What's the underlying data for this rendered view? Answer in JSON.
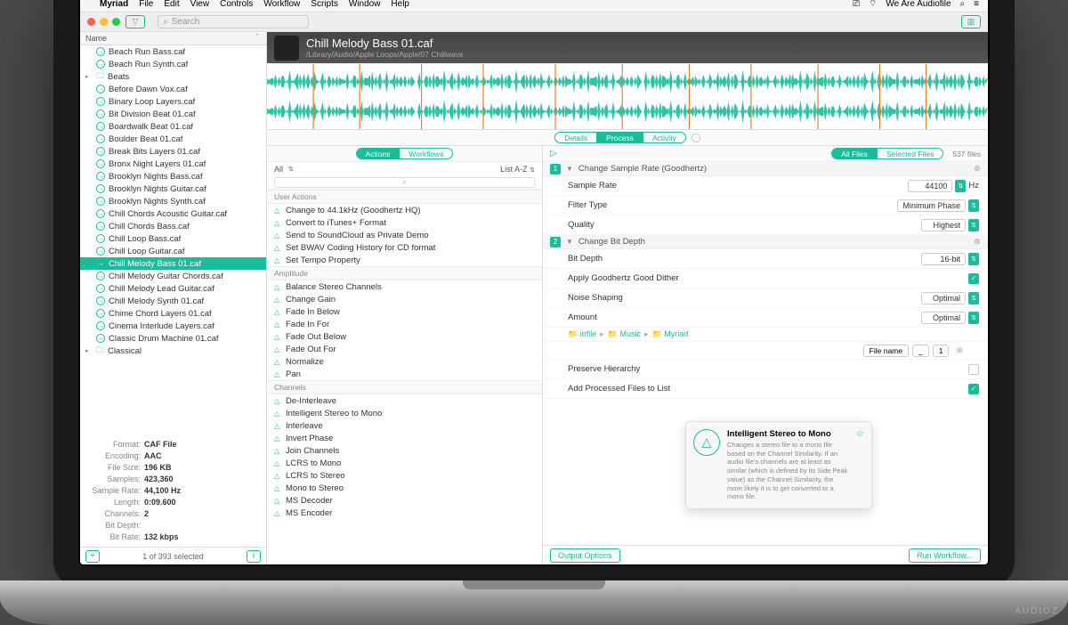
{
  "menubar": {
    "app": "Myriad",
    "items": [
      "File",
      "Edit",
      "View",
      "Controls",
      "Workflow",
      "Scripts",
      "Window",
      "Help"
    ],
    "right": "We Are Audiofile"
  },
  "toolbar": {
    "search_placeholder": "Search"
  },
  "list": {
    "header": "Name",
    "status": "1 of 393 selected"
  },
  "files": [
    {
      "name": "Beach Run Bass.caf",
      "icon": "a"
    },
    {
      "name": "Beach Run Synth.caf",
      "icon": "a"
    },
    {
      "name": "Beats",
      "folder": true,
      "expand": true
    },
    {
      "name": "Before Dawn Vox.caf",
      "icon": "a"
    },
    {
      "name": "Binary Loop Layers.caf",
      "icon": "a"
    },
    {
      "name": "Bit Division Beat 01.caf",
      "icon": "a"
    },
    {
      "name": "Boardwalk Beat 01.caf",
      "icon": "a"
    },
    {
      "name": "Boulder Beat 01.caf",
      "icon": "a"
    },
    {
      "name": "Break Bits Layers 01.caf",
      "icon": "a"
    },
    {
      "name": "Bronx Night Layers 01.caf",
      "icon": "a"
    },
    {
      "name": "Brooklyn Nights Bass.caf",
      "icon": "a"
    },
    {
      "name": "Brooklyn Nights Guitar.caf",
      "icon": "a"
    },
    {
      "name": "Brooklyn Nights Synth.caf",
      "icon": "a"
    },
    {
      "name": "Chill Chords Acoustic Guitar.caf",
      "icon": "a"
    },
    {
      "name": "Chill Chords Bass.caf",
      "icon": "a"
    },
    {
      "name": "Chill Loop Bass.caf",
      "icon": "a"
    },
    {
      "name": "Chill Loop Guitar.caf",
      "icon": "a"
    },
    {
      "name": "Chill Melody Bass 01.caf",
      "icon": "a",
      "selected": true
    },
    {
      "name": "Chill Melody Guitar Chords.caf",
      "icon": "a"
    },
    {
      "name": "Chill Melody Lead Guitar.caf",
      "icon": "a"
    },
    {
      "name": "Chill Melody Synth 01.caf",
      "icon": "a"
    },
    {
      "name": "Chime Chord Layers 01.caf",
      "icon": "a"
    },
    {
      "name": "Cinema Interlude Layers.caf",
      "icon": "a"
    },
    {
      "name": "Classic Drum Machine 01.caf",
      "icon": "a"
    },
    {
      "name": "Classical",
      "folder": true,
      "expand": true
    }
  ],
  "info": [
    {
      "k": "Format:",
      "v": "CAF File"
    },
    {
      "k": "Encoding:",
      "v": "AAC"
    },
    {
      "k": "File Size:",
      "v": "196 KB"
    },
    {
      "k": "Samples:",
      "v": "423,360"
    },
    {
      "k": "Sample Rate:",
      "v": "44,100 Hz"
    },
    {
      "k": "Length:",
      "v": "0:09.600"
    },
    {
      "k": "Channels:",
      "v": "2"
    },
    {
      "k": "Bit Depth:",
      "v": ""
    },
    {
      "k": "Bit Rate:",
      "v": "132 kbps"
    }
  ],
  "file": {
    "name": "Chill Melody Bass 01.caf",
    "path": "/Library/Audio/Apple Loops/Apple/07 Chillwave"
  },
  "detail_tabs": {
    "t1": "Details",
    "t2": "Process",
    "t3": "Activity"
  },
  "actions_tabs": {
    "t1": "Actions",
    "t2": "Workflows"
  },
  "filter": {
    "all": "All",
    "sort": "List A-Z"
  },
  "action_sections": [
    {
      "title": "User Actions",
      "items": [
        "Change to 44.1kHz (Goodhertz HQ)",
        "Convert to iTunes+ Format",
        "Send to SoundCloud as Private Demo",
        "Set BWAV Coding History for CD format",
        "Set Tempo Property"
      ]
    },
    {
      "title": "Amplitude",
      "items": [
        "Balance Stereo Channels",
        "Change Gain",
        "Fade In Below",
        "Fade In For",
        "Fade Out Below",
        "Fade Out For",
        "Normalize",
        "Pan"
      ]
    },
    {
      "title": "Channels",
      "items": [
        "De-Interleave",
        "Intelligent Stereo to Mono",
        "Interleave",
        "Invert Phase",
        "Join Channels",
        "LCRS to Mono",
        "LCRS to Stereo",
        "Mono to Stereo",
        "MS Decoder",
        "MS Encoder"
      ]
    }
  ],
  "wf_tabs": {
    "t1": "All Files",
    "t2": "Selected Files",
    "count": "537 files"
  },
  "steps": [
    {
      "n": "1",
      "title": "Change Sample Rate (Goodhertz)",
      "params": [
        {
          "k": "Sample Rate",
          "v": "44100",
          "unit": "Hz",
          "type": "num"
        },
        {
          "k": "Filter Type",
          "v": "Minimum Phase",
          "type": "sel"
        },
        {
          "k": "Quality",
          "v": "Highest",
          "type": "sel"
        }
      ]
    },
    {
      "n": "2",
      "title": "Change Bit Depth",
      "params": [
        {
          "k": "Bit Depth",
          "v": "16-bit",
          "type": "sel"
        },
        {
          "k": "Apply Goodhertz Good Dither",
          "type": "check",
          "checked": true
        },
        {
          "k": "Noise Shaping",
          "v": "Optimal",
          "type": "sel"
        },
        {
          "k": "Amount",
          "v": "Optimal",
          "type": "sel"
        }
      ]
    }
  ],
  "breadcrumb": [
    "iofile",
    "Music",
    "Myriad"
  ],
  "filename": {
    "label": "File name",
    "sep": "_",
    "n": "1"
  },
  "extra_params": [
    {
      "k": "Preserve Hierarchy",
      "type": "check",
      "checked": false
    },
    {
      "k": "Add Processed Files to List",
      "type": "check",
      "checked": true
    }
  ],
  "wf_footer": {
    "out": "Output Options",
    "run": "Run Workflow..."
  },
  "tooltip": {
    "title": "Intelligent Stereo to Mono",
    "body": "Changes a stereo file to a mono file based on the Channel Similarity. If an audio file's channels are at least as similar (which is defined by its Side Peak value) as the Channel Similarity, the more likely it is to get converted to a mono file."
  },
  "watermark": "AUDIOZ"
}
